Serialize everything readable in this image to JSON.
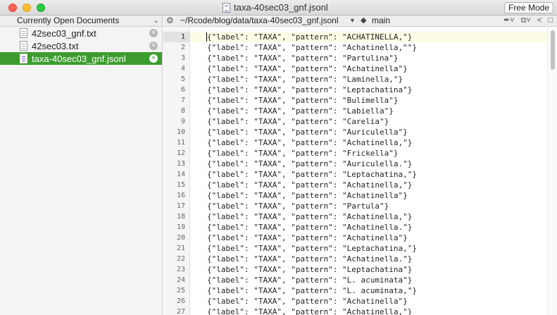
{
  "window": {
    "title": "taxa-40sec03_gnf.jsonl",
    "free_mode_label": "Free Mode"
  },
  "sidebar": {
    "header": "Currently Open Documents",
    "items": [
      {
        "label": "42sec03_gnf.txt",
        "active": false
      },
      {
        "label": "42sec03.txt",
        "active": false
      },
      {
        "label": "taxa-40sec03_gnf.jsonl",
        "active": true
      }
    ]
  },
  "navbar": {
    "path": "~/Rcode/blog/data/taxa-40sec03_gnf.jsonl",
    "branch": "main"
  },
  "editor": {
    "current_line": 1,
    "lines": [
      {
        "num": "1",
        "text": "{\"label\": \"TAXA\", \"pattern\": \"ACHATINELLA,\"}"
      },
      {
        "num": "2",
        "text": "{\"label\": \"TAXA\", \"pattern\": \"Achatinella,^\"}"
      },
      {
        "num": "3",
        "text": "{\"label\": \"TAXA\", \"pattern\": \"Partulina\"}"
      },
      {
        "num": "4",
        "text": "{\"label\": \"TAXA\", \"pattern\": \"Achatinella\"}"
      },
      {
        "num": "5",
        "text": "{\"label\": \"TAXA\", \"pattern\": \"Laminella,\"}"
      },
      {
        "num": "6",
        "text": "{\"label\": \"TAXA\", \"pattern\": \"Leptachatina\"}"
      },
      {
        "num": "7",
        "text": "{\"label\": \"TAXA\", \"pattern\": \"Bulimella\"}"
      },
      {
        "num": "8",
        "text": "{\"label\": \"TAXA\", \"pattern\": \"Labiella\"}"
      },
      {
        "num": "9",
        "text": "{\"label\": \"TAXA\", \"pattern\": \"Carelia\"}"
      },
      {
        "num": "10",
        "text": "{\"label\": \"TAXA\", \"pattern\": \"Auriculella\"}"
      },
      {
        "num": "11",
        "text": "{\"label\": \"TAXA\", \"pattern\": \"Achatinella,\"}"
      },
      {
        "num": "12",
        "text": "{\"label\": \"TAXA\", \"pattern\": \"Frickella\"}"
      },
      {
        "num": "13",
        "text": "{\"label\": \"TAXA\", \"pattern\": \"Auriculella.\"}"
      },
      {
        "num": "14",
        "text": "{\"label\": \"TAXA\", \"pattern\": \"Leptachatina,\"}"
      },
      {
        "num": "15",
        "text": "{\"label\": \"TAXA\", \"pattern\": \"Achatinella,\"}"
      },
      {
        "num": "16",
        "text": "{\"label\": \"TAXA\", \"pattern\": \"Achatinella\"}"
      },
      {
        "num": "17",
        "text": "{\"label\": \"TAXA\", \"pattern\": \"Partula\"}"
      },
      {
        "num": "18",
        "text": "{\"label\": \"TAXA\", \"pattern\": \"Achatinella,\"}"
      },
      {
        "num": "19",
        "text": "{\"label\": \"TAXA\", \"pattern\": \"Achatinella.\"}"
      },
      {
        "num": "20",
        "text": "{\"label\": \"TAXA\", \"pattern\": \"Achatinella\"}"
      },
      {
        "num": "21",
        "text": "{\"label\": \"TAXA\", \"pattern\": \"Leptachatina,\"}"
      },
      {
        "num": "22",
        "text": "{\"label\": \"TAXA\", \"pattern\": \"Achatinella.\"}"
      },
      {
        "num": "23",
        "text": "{\"label\": \"TAXA\", \"pattern\": \"Leptachatina\"}"
      },
      {
        "num": "24",
        "text": "{\"label\": \"TAXA\", \"pattern\": \"L. acuminata\"}"
      },
      {
        "num": "25",
        "text": "{\"label\": \"TAXA\", \"pattern\": \"L. acuminata,\"}"
      },
      {
        "num": "26",
        "text": "{\"label\": \"TAXA\", \"pattern\": \"Achatinella\"}"
      },
      {
        "num": "27",
        "text": "{\"label\": \"TAXA\", \"pattern\": \"Achatinella,\"}"
      }
    ]
  },
  "colors": {
    "active_item": "#3c9d2e",
    "current_line": "#fdfce6"
  }
}
